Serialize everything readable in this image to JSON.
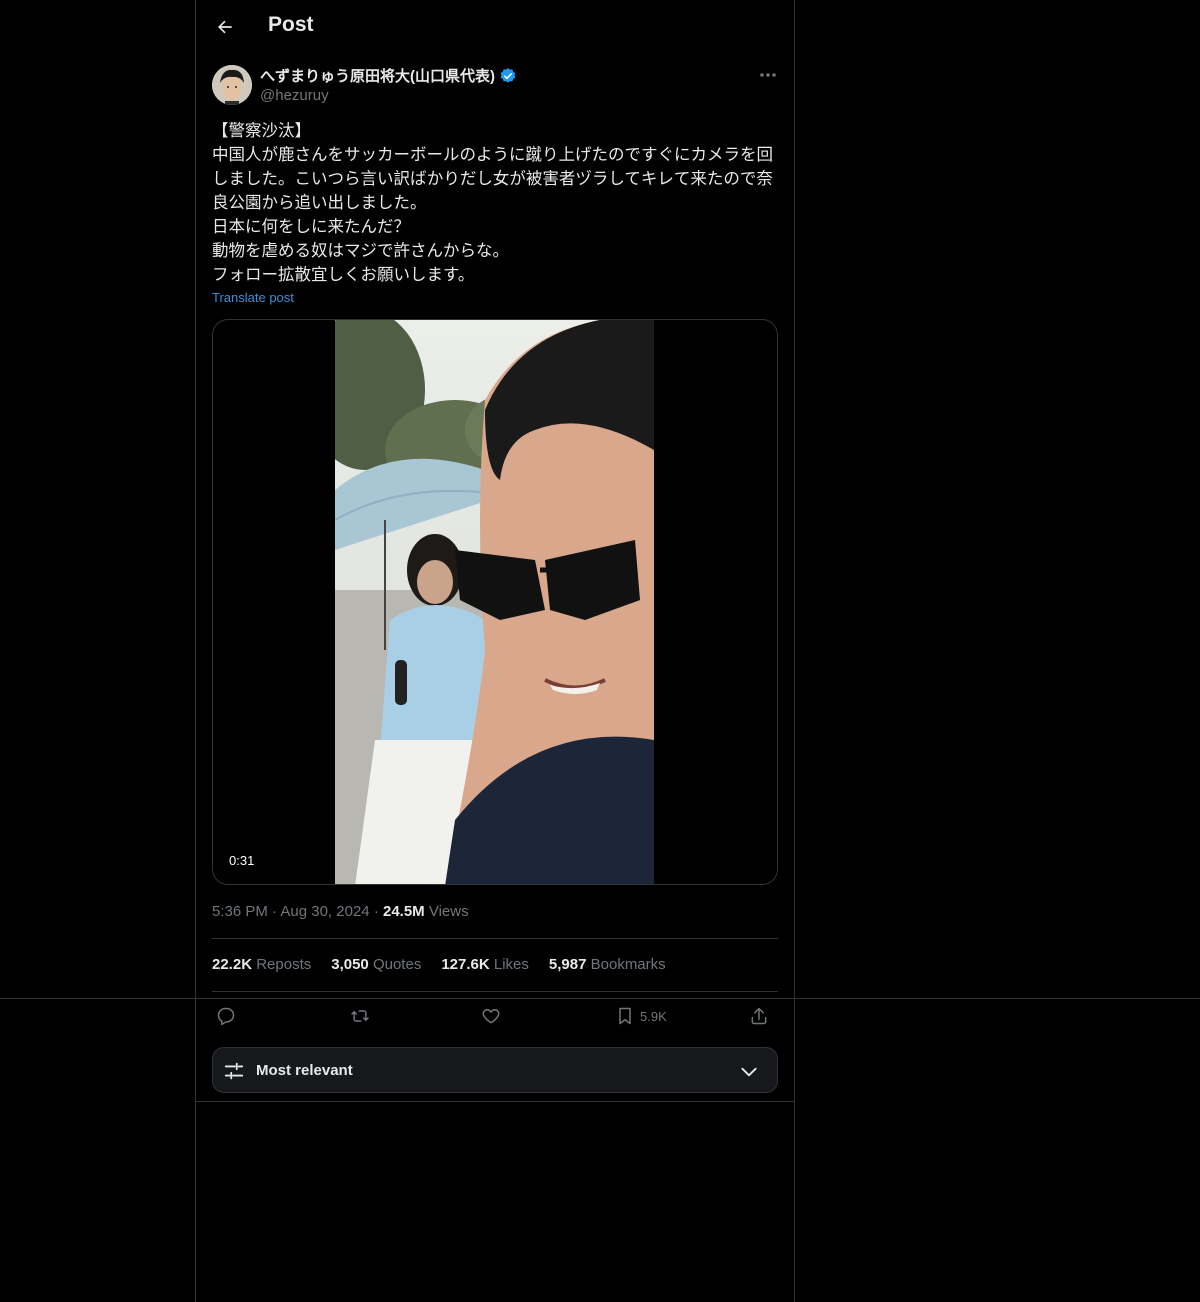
{
  "header": {
    "title": "Post",
    "back_icon": "arrow-left-icon"
  },
  "author": {
    "display_name": "へずまりゅう原田将大(山口県代表)",
    "handle": "@hezuruy",
    "verified": true
  },
  "post": {
    "text": "【警察沙汰】\n中国人が鹿さんをサッカーボールのように蹴り上げたのですぐにカメラを回しました。こいつら言い訳ばかりだし女が被害者ヅラしてキレて来たので奈良公園から追い出しました。\n日本に何をしに来たんだ？\n動物を虐める奴はマジで許さんからな。\nフォロー拡散宜しくお願いします。",
    "translate_label": "Translate post",
    "video_duration": "0:31"
  },
  "meta": {
    "time": "5:36 PM",
    "separator": "·",
    "date": "Aug 30, 2024",
    "views_count": "24.5M",
    "views_label": "Views"
  },
  "stats": [
    {
      "count": "22.2K",
      "label": "Reposts"
    },
    {
      "count": "3,050",
      "label": "Quotes"
    },
    {
      "count": "127.6K",
      "label": "Likes"
    },
    {
      "count": "5,987",
      "label": "Bookmarks"
    }
  ],
  "actions": {
    "bookmark_count": "5.9K"
  },
  "sort": {
    "label": "Most relevant"
  },
  "colors": {
    "background": "#000000",
    "border": "#2f3336",
    "accent": "#1d9bf0",
    "muted": "#71767b"
  }
}
